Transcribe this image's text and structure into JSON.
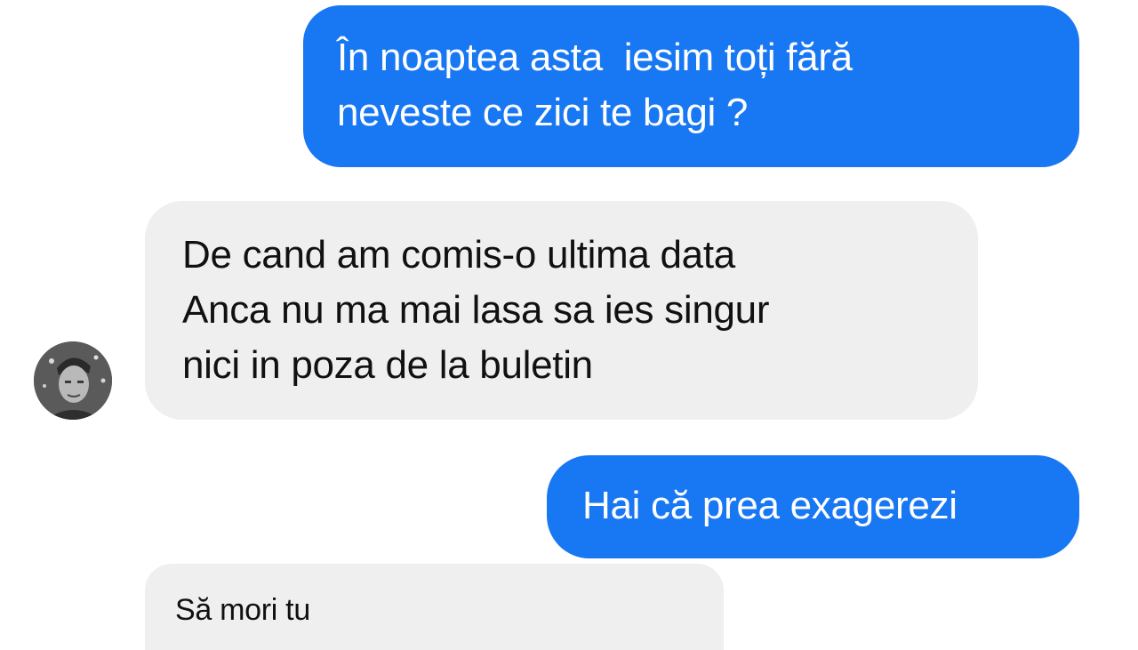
{
  "messages": [
    {
      "direction": "outgoing",
      "lines": [
        "În noaptea asta  iesim toți fără",
        "neveste ce zici te bagi ?"
      ]
    },
    {
      "direction": "incoming",
      "lines": [
        "De cand am comis-o ultima data",
        "Anca nu ma mai lasa sa ies singur",
        "nici in poza de la buletin"
      ]
    },
    {
      "direction": "outgoing",
      "lines": [
        "Hai că prea exagerezi"
      ]
    },
    {
      "direction": "incoming",
      "lines": [
        "Să mori tu"
      ]
    }
  ],
  "contact": {
    "avatar_icon": "user-avatar-icon"
  },
  "colors": {
    "outgoing_bubble": "#1877f2",
    "incoming_bubble": "#efefef",
    "outgoing_text": "#ffffff",
    "incoming_text": "#111111"
  }
}
